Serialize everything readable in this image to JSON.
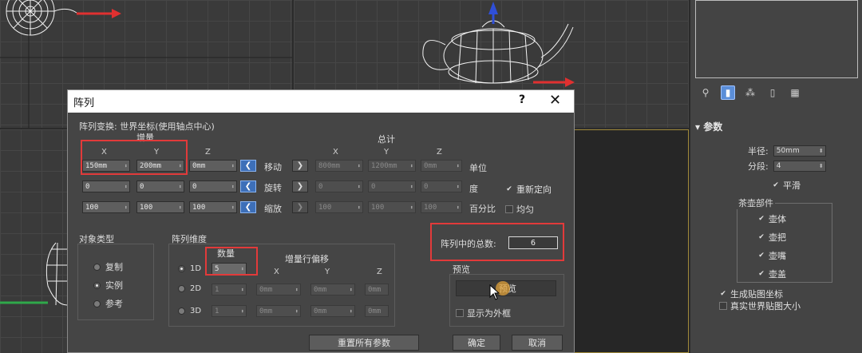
{
  "dialog": {
    "title": "阵列",
    "help": "?",
    "close": "✕",
    "transform_label": "阵列变换: 世界坐标(使用轴点中心)",
    "increment_label": "增量",
    "total_label": "总计",
    "axes": [
      "X",
      "Y",
      "Z"
    ],
    "rows": [
      {
        "name": "移动",
        "inc": [
          "150mm",
          "200mm",
          "0mm"
        ],
        "tot": [
          "800mm",
          "1200mm",
          "0mm"
        ],
        "unit": "单位"
      },
      {
        "name": "旋转",
        "inc": [
          "0",
          "0",
          "0"
        ],
        "tot": [
          "0",
          "0",
          "0"
        ],
        "unit": "度"
      },
      {
        "name": "缩放",
        "inc": [
          "100",
          "100",
          "100"
        ],
        "tot": [
          "100",
          "100",
          "100"
        ],
        "unit": "百分比"
      }
    ],
    "reorient_label": "重新定向",
    "uniform_label": "均匀",
    "object_type": {
      "title": "对象类型",
      "options": [
        "复制",
        "实例",
        "参考"
      ],
      "selected": "实例"
    },
    "dimensions": {
      "title": "阵列维度",
      "count_label": "数量",
      "offset_label": "增量行偏移",
      "axes": [
        "X",
        "Y",
        "Z"
      ],
      "rows": [
        {
          "label": "1D",
          "count": "5",
          "offs": [
            "",
            "",
            ""
          ]
        },
        {
          "label": "2D",
          "count": "1",
          "offs": [
            "0mm",
            "0mm",
            "0mm"
          ]
        },
        {
          "label": "3D",
          "count": "1",
          "offs": [
            "0mm",
            "0mm",
            "0mm"
          ]
        }
      ],
      "selected": "1D"
    },
    "total_count_label": "阵列中的总数:",
    "total_count_value": "6",
    "preview": {
      "title": "预览",
      "button": "预览",
      "show_box": "显示为外框"
    },
    "buttons": {
      "reset": "重置所有参数",
      "ok": "确定",
      "cancel": "取消"
    }
  },
  "command_panel": {
    "rollout_title": "参数",
    "radius_label": "半径:",
    "radius_value": "50mm",
    "segments_label": "分段:",
    "segments_value": "4",
    "smooth_label": "平滑",
    "parts_title": "茶壶部件",
    "parts": [
      "壶体",
      "壶把",
      "壶嘴",
      "壶盖"
    ],
    "gen_map_label": "生成贴图坐标",
    "real_world_label": "真实世界贴图大小"
  },
  "colors": {
    "highlight": "#e23a3a",
    "accent": "#3d6fb8"
  }
}
